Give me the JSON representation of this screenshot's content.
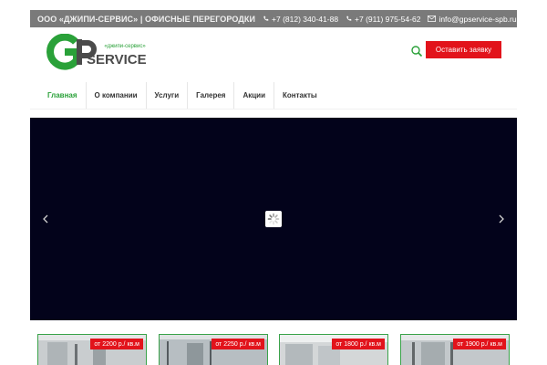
{
  "topbar": {
    "company": "ООО «ДЖИПИ-СЕРВИС» | ОФИСНЫЕ ПЕРЕГОРОДКИ",
    "phone1": "+7 (812) 340-41-88",
    "phone2": "+7 (911) 975-54-62",
    "email": "info@gpservice-spb.ru"
  },
  "header": {
    "logo_letters": "GP",
    "logo_tagline": "«джипи-сервис»",
    "logo_word": "SERVICE",
    "cta_label": "Оставить заявку"
  },
  "nav": {
    "items": [
      {
        "label": "Главная"
      },
      {
        "label": "О компании"
      },
      {
        "label": "Услуги"
      },
      {
        "label": "Галерея"
      },
      {
        "label": "Акции"
      },
      {
        "label": "Контакты"
      }
    ]
  },
  "products": [
    {
      "price": "от 2200 р./ кв.м"
    },
    {
      "price": "от 2250 р./ кв.м"
    },
    {
      "price": "от 1800 р./ кв.м"
    },
    {
      "price": "от 1900 р./ кв.м"
    }
  ],
  "colors": {
    "brand_green": "#2aa139",
    "brand_dark": "#4b4b4b",
    "accent_red": "#e2131b",
    "topbar_bg": "#7a7a7a",
    "slider_bg": "#03031b"
  },
  "icons": [
    "phone-icon",
    "envelope-icon",
    "search-icon",
    "chevron-left-icon",
    "chevron-right-icon",
    "loading-spinner-icon"
  ]
}
